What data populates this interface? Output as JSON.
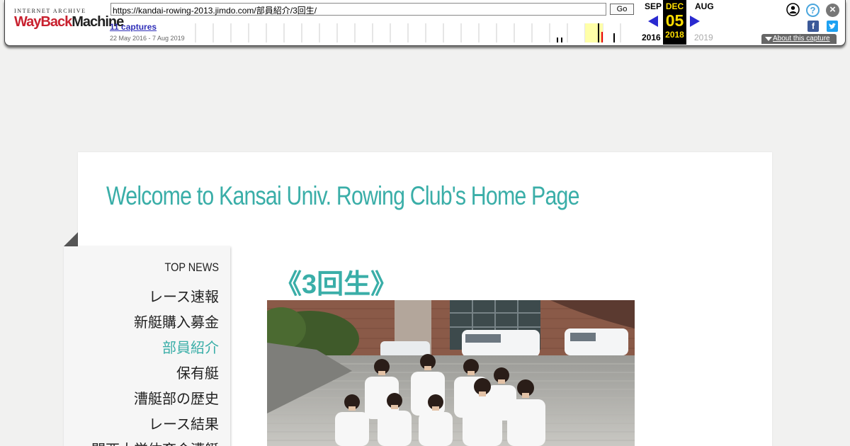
{
  "wayback": {
    "logo_top": "INTERNET ARCHIVE",
    "logo_main_1": "WayBack",
    "logo_main_2": "Machine",
    "url": "https://kandai-rowing-2013.jimdo.com/部員紹介/3回生/",
    "go_label": "Go",
    "captures": "11 captures",
    "range": "22 May 2016 - 7 Aug 2019",
    "prev_month": "SEP",
    "prev_year": "2016",
    "cur_month": "DEC",
    "cur_day": "05",
    "cur_year": "2018",
    "next_month": "AUG",
    "next_year": "2019",
    "about": "About this capture",
    "facebook_glyph": "f",
    "help_glyph": "?",
    "close_glyph": "×",
    "colors": {
      "current": "#ffde00",
      "arrow": "#2a2ad0",
      "captures": "#2e2eb8"
    }
  },
  "site": {
    "title": "Welcome to Kansai Univ. Rowing Club's Home Page",
    "accent_color": "#3aaea8"
  },
  "nav": {
    "items": [
      {
        "label": "TOP NEWS"
      },
      {
        "label": "レース速報"
      },
      {
        "label": "新艇購入募金"
      },
      {
        "label": "部員紹介",
        "active": true
      },
      {
        "label": "保有艇"
      },
      {
        "label": "漕艇部の歴史"
      },
      {
        "label": "レース結果"
      },
      {
        "label": "関西大学体育会漕艇"
      }
    ]
  },
  "main": {
    "heading": "《3回生》"
  }
}
